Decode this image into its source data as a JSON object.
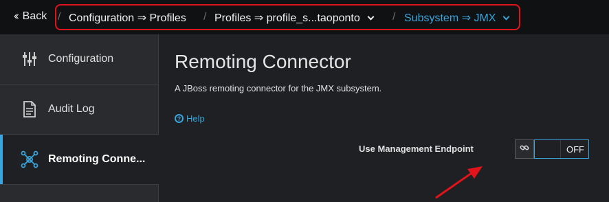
{
  "breadcrumb": {
    "back_label": "Back",
    "items": [
      {
        "label": "Configuration ⇒ Profiles"
      },
      {
        "label": "Profiles ⇒ profile_s...taoponto"
      },
      {
        "label": "Subsystem ⇒ JMX"
      }
    ],
    "separator": "/"
  },
  "sidebar": {
    "items": [
      {
        "label": "Configuration",
        "icon": "sliders-icon",
        "active": false
      },
      {
        "label": "Audit Log",
        "icon": "document-icon",
        "active": false
      },
      {
        "label": "Remoting Conne...",
        "icon": "network-icon",
        "active": true
      }
    ]
  },
  "main": {
    "title": "Remoting Connector",
    "description": "A JBoss remoting connector for the JMX subsystem.",
    "help_label": "Help",
    "field": {
      "label": "Use Management Endpoint",
      "toggle_state": "OFF"
    }
  },
  "colors": {
    "accent": "#39a5dc",
    "highlight": "#e1141b",
    "background": "#1e2023",
    "sidebar": "#292b2e"
  }
}
